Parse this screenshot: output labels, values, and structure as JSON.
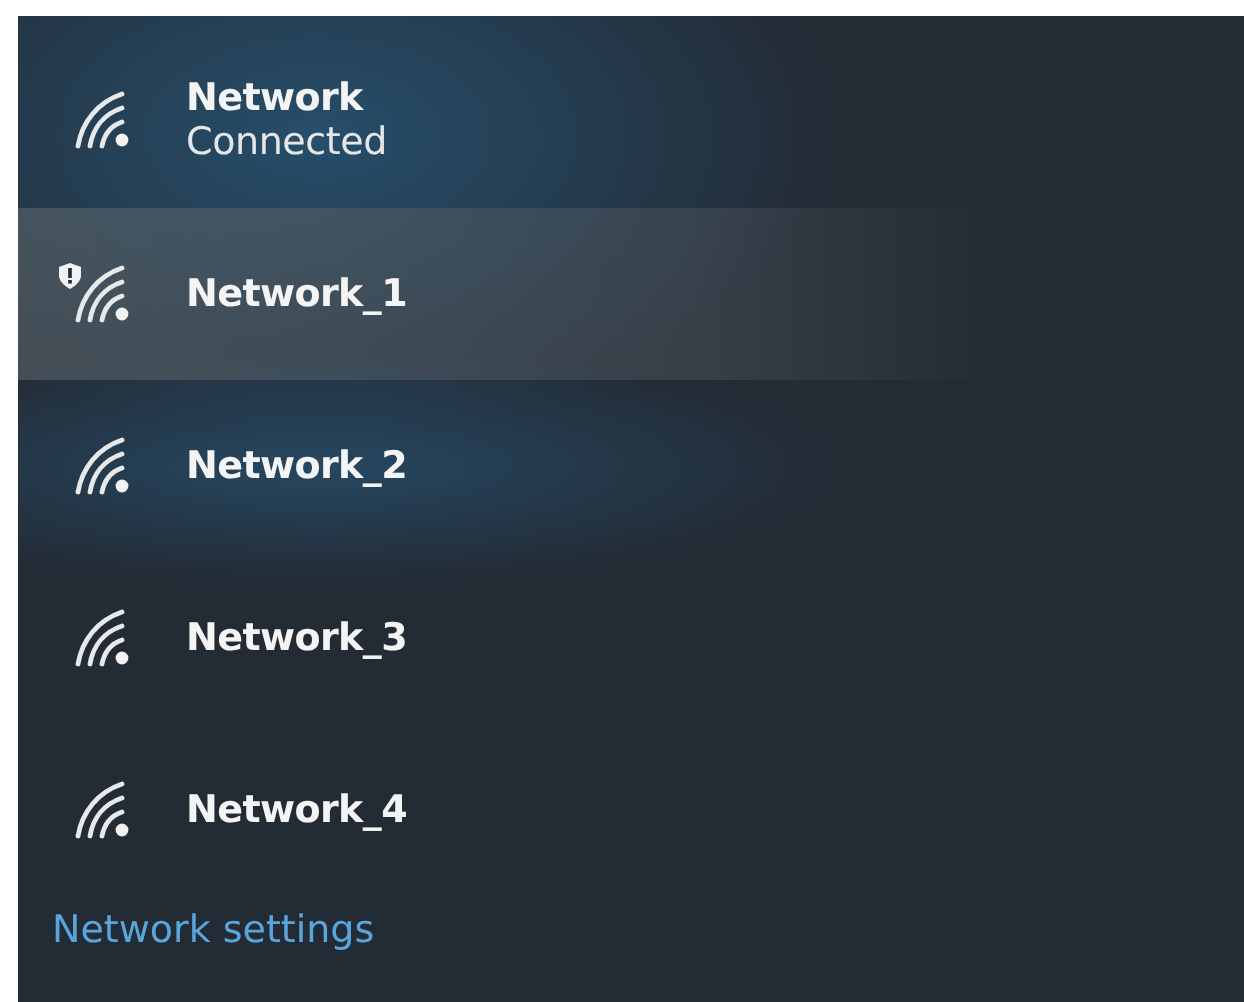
{
  "networks": [
    {
      "name": "Network",
      "status": "Connected",
      "selected": false,
      "warning": false
    },
    {
      "name": "Network_1",
      "selected": true,
      "warning": true
    },
    {
      "name": "Network_2",
      "selected": false,
      "warning": false
    },
    {
      "name": "Network_3",
      "selected": false,
      "warning": false
    },
    {
      "name": "Network_4",
      "selected": false,
      "warning": false
    }
  ],
  "settings_link": "Network settings"
}
